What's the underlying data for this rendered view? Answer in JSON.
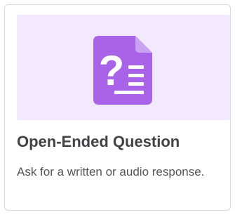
{
  "card": {
    "title": "Open-Ended Question",
    "description": "Ask for a written or audio response.",
    "icon": "question-document-icon",
    "accent_color": "#a863e8",
    "thumbnail_bg": "#f3e9fd"
  }
}
